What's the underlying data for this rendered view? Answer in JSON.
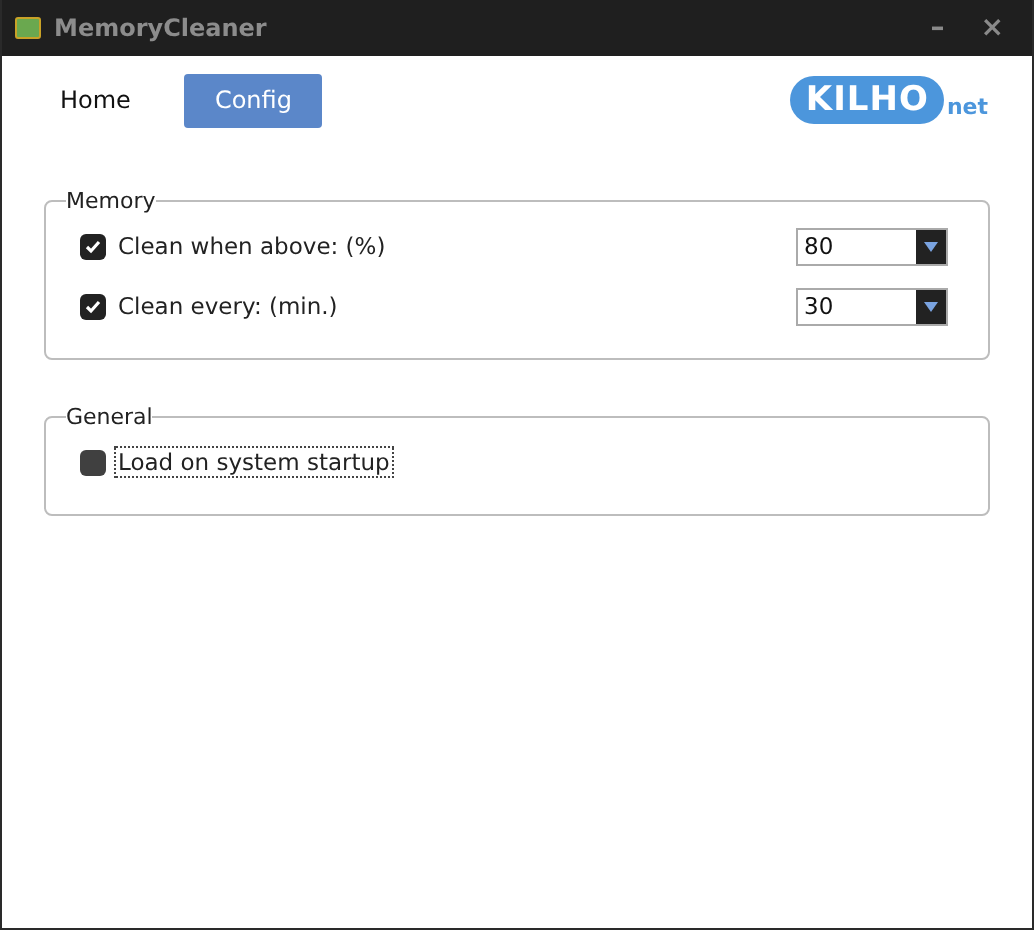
{
  "window": {
    "title": "MemoryCleaner",
    "controls": [
      "–",
      "×"
    ]
  },
  "tabs": [
    {
      "label": "Home",
      "selected": false
    },
    {
      "label": "Config",
      "selected": true
    }
  ],
  "logo": {
    "main": "KILHO",
    "suffix": "net"
  },
  "groups": [
    {
      "title": "Memory",
      "options": [
        {
          "label": "Clean when above: (%)",
          "checked": true,
          "focused": false,
          "value": "80"
        },
        {
          "label": "Clean every: (min.)",
          "checked": true,
          "focused": false,
          "value": "30"
        }
      ]
    },
    {
      "title": "General",
      "options": [
        {
          "label": "Load on system startup",
          "checked": false,
          "focused": true
        }
      ]
    }
  ]
}
